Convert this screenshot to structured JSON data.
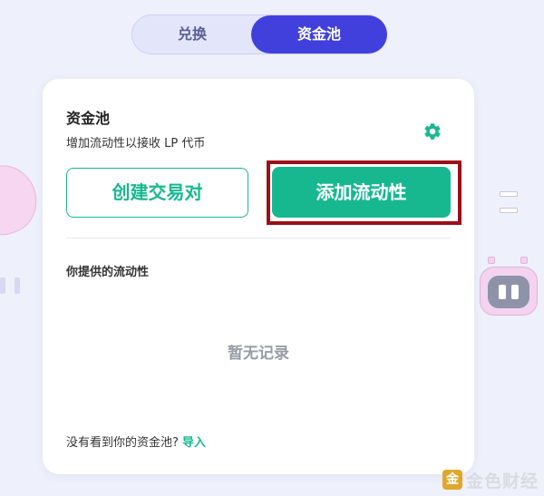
{
  "tabs": {
    "swap_label": "兑换",
    "pool_label": "资金池",
    "active": "pool"
  },
  "card": {
    "title": "资金池",
    "subtitle": "增加流动性以接收 LP 代币",
    "settings_icon": "gear-icon",
    "create_pair_label": "创建交易对",
    "add_liquidity_label": "添加流动性",
    "your_liquidity_title": "你提供的流动性",
    "empty_text": "暂无记录",
    "footer_text": "没有看到你的资金池?",
    "footer_link": "导入"
  },
  "watermark": {
    "logo_glyph": "金",
    "text": "金色财经"
  },
  "colors": {
    "accent": "#17b890",
    "tab_active": "#4140dc",
    "highlight": "#9b0f18",
    "background": "#eef0fb"
  }
}
